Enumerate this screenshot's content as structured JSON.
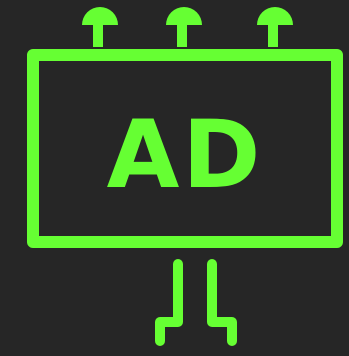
{
  "icon": {
    "name": "billboard-icon",
    "label": "AD"
  },
  "colors": {
    "background": "#262626",
    "accent": "#66ff33"
  }
}
